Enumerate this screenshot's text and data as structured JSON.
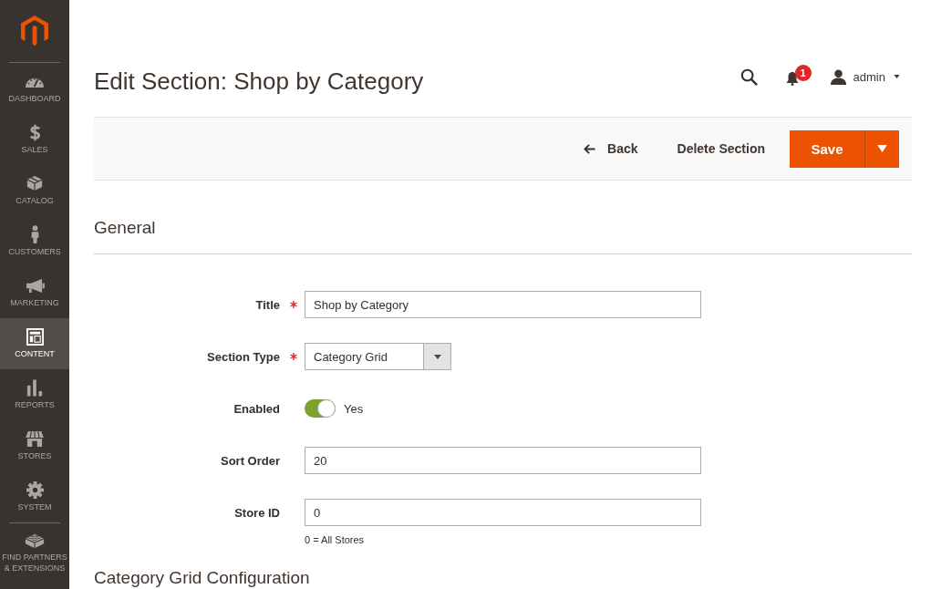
{
  "sidebar": {
    "items": [
      {
        "label": "DASHBOARD",
        "selected": false
      },
      {
        "label": "SALES",
        "selected": false
      },
      {
        "label": "CATALOG",
        "selected": false
      },
      {
        "label": "CUSTOMERS",
        "selected": false
      },
      {
        "label": "MARKETING",
        "selected": false
      },
      {
        "label": "CONTENT",
        "selected": true
      },
      {
        "label": "REPORTS",
        "selected": false
      },
      {
        "label": "STORES",
        "selected": false
      },
      {
        "label": "SYSTEM",
        "selected": false
      }
    ],
    "extensions_item": {
      "label": "FIND PARTNERS & EXTENSIONS",
      "selected": false
    }
  },
  "header": {
    "title": "Edit Section: Shop by Category",
    "notification_count": "1",
    "user": "admin"
  },
  "page_actions": {
    "back": "Back",
    "delete": "Delete Section",
    "save": "Save"
  },
  "general": {
    "title": "General",
    "fields": [
      {
        "kind": "text",
        "label": "Title",
        "required": true,
        "value": "Shop by Category"
      },
      {
        "kind": "select",
        "label": "Section Type",
        "required": true,
        "value": "Category Grid"
      },
      {
        "kind": "toggle",
        "label": "Enabled",
        "required": false,
        "on": true,
        "state_label": "Yes"
      },
      {
        "kind": "text",
        "label": "Sort Order",
        "required": false,
        "value": "20"
      },
      {
        "kind": "text",
        "label": "Store ID",
        "required": false,
        "value": "0",
        "note": "0 = All Stores"
      }
    ]
  },
  "next_section": {
    "title": "Category Grid Configuration"
  }
}
